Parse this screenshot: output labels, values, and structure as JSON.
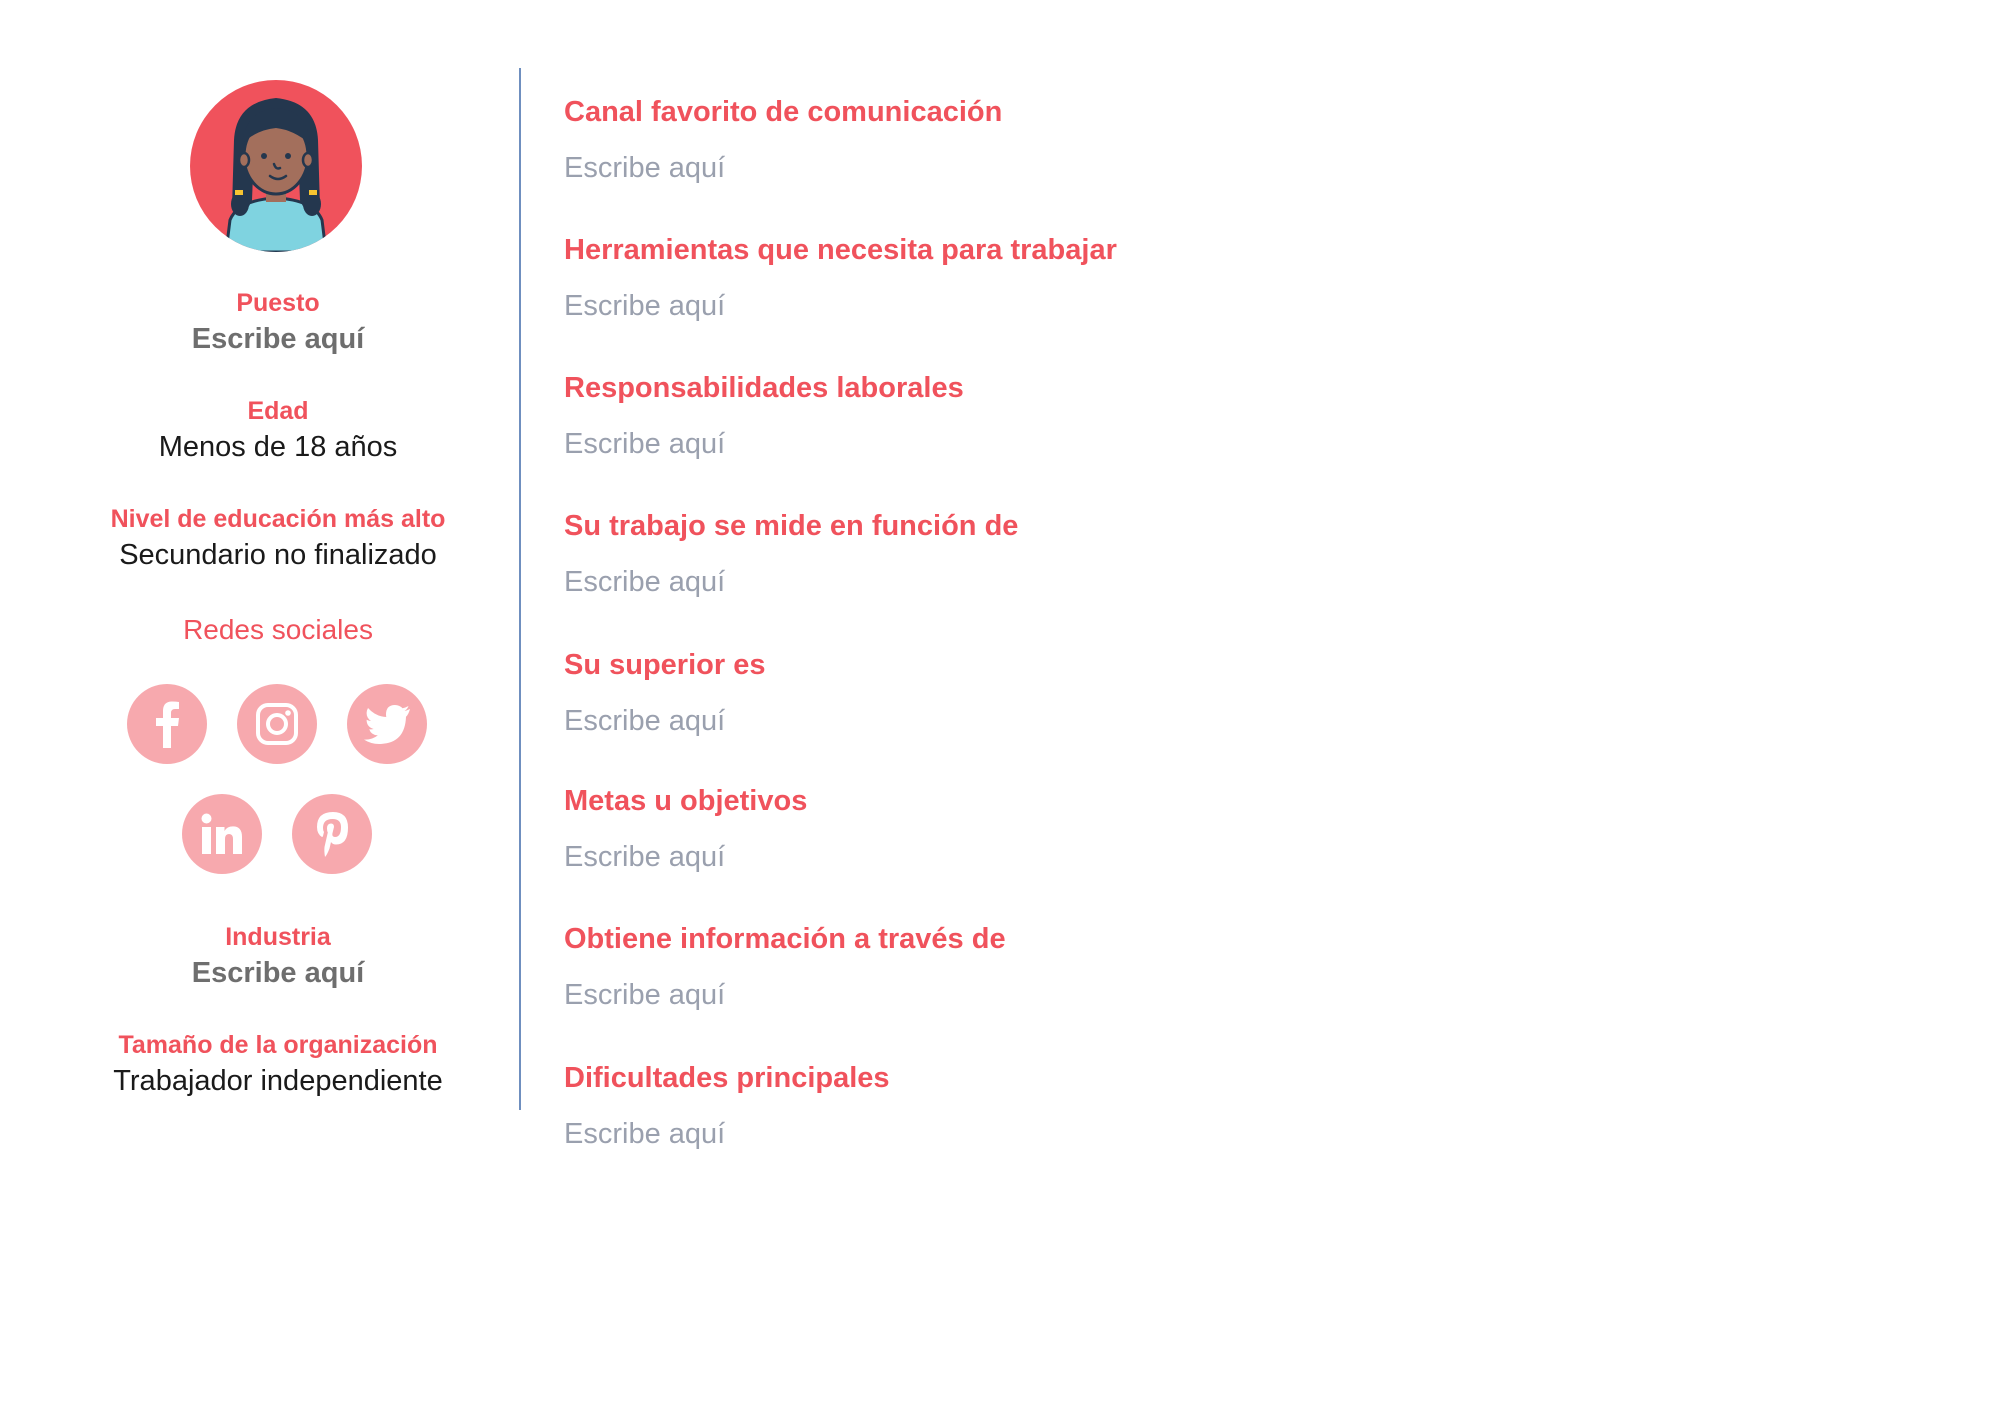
{
  "profile": {
    "puesto": {
      "label": "Puesto",
      "value": "Escribe aquí"
    },
    "edad": {
      "label": "Edad",
      "value": "Menos de 18 años"
    },
    "educacion": {
      "label": "Nivel de educación más alto",
      "value": "Secundario no finalizado"
    },
    "redes": {
      "label": "Redes sociales",
      "icons": [
        "facebook-icon",
        "instagram-icon",
        "twitter-icon",
        "linkedin-icon",
        "pinterest-icon"
      ]
    },
    "industria": {
      "label": "Industria",
      "value": "Escribe aquí"
    },
    "tamano": {
      "label": "Tamaño de la organización",
      "value": "Trabajador independiente"
    }
  },
  "fields": [
    {
      "label": "Canal favorito de comunicación",
      "value": "Escribe aquí"
    },
    {
      "label": "Herramientas que necesita para trabajar",
      "value": "Escribe aquí"
    },
    {
      "label": "Responsabilidades laborales",
      "value": "Escribe aquí"
    },
    {
      "label": "Su trabajo se mide en función de",
      "value": "Escribe aquí"
    },
    {
      "label": "Su superior es",
      "value": "Escribe aquí"
    },
    {
      "label": "Metas u objetivos",
      "value": "Escribe aquí"
    },
    {
      "label": "Obtiene información a través de",
      "value": "Escribe aquí"
    },
    {
      "label": "Dificultades principales",
      "value": "Escribe aquí"
    }
  ],
  "colors": {
    "accent": "#f0525c",
    "social_icon_bg": "#f7a9ae",
    "placeholder_text": "#9aa0ae",
    "divider": "#6f8fbf"
  }
}
